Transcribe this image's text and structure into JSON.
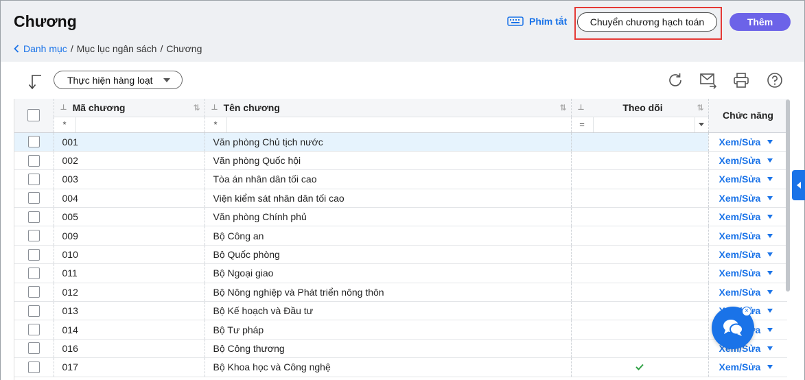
{
  "header": {
    "title": "Chương",
    "breadcrumb": {
      "back": "Danh mục",
      "sep1": "/",
      "item2": "Mục lục ngân sách",
      "sep2": "/",
      "item3": "Chương"
    },
    "shortcut_label": "Phím tắt",
    "move_button": "Chuyển chương hạch toán",
    "add_button": "Thêm"
  },
  "toolbar": {
    "bulk_label": "Thực hiện hàng loạt"
  },
  "table": {
    "columns": {
      "code": "Mã chương",
      "name": "Tên chương",
      "follow": "Theo dõi",
      "action": "Chức năng"
    },
    "filters": {
      "code": "*",
      "name": "*",
      "follow": "="
    },
    "action_label": "Xem/Sửa",
    "rows": [
      {
        "code": "001",
        "name": "Văn phòng Chủ tịch nước",
        "followed": false,
        "selected": true
      },
      {
        "code": "002",
        "name": "Văn phòng Quốc hội",
        "followed": false
      },
      {
        "code": "003",
        "name": "Tòa án nhân dân tối cao",
        "followed": false
      },
      {
        "code": "004",
        "name": "Viện kiểm sát nhân dân tối cao",
        "followed": false
      },
      {
        "code": "005",
        "name": "Văn phòng Chính phủ",
        "followed": false
      },
      {
        "code": "009",
        "name": "Bộ Công an",
        "followed": false
      },
      {
        "code": "010",
        "name": "Bộ Quốc phòng",
        "followed": false
      },
      {
        "code": "011",
        "name": "Bộ Ngoại giao",
        "followed": false
      },
      {
        "code": "012",
        "name": "Bộ Nông nghiệp và Phát triển nông thôn",
        "followed": false
      },
      {
        "code": "013",
        "name": "Bộ Kế hoạch và Đầu tư",
        "followed": false
      },
      {
        "code": "014",
        "name": "Bộ Tư pháp",
        "followed": false
      },
      {
        "code": "016",
        "name": "Bộ Công thương",
        "followed": false
      },
      {
        "code": "017",
        "name": "Bộ Khoa học và Công nghệ",
        "followed": true
      }
    ]
  },
  "chat": {
    "close_label": "×"
  },
  "colors": {
    "accent": "#1a73e8",
    "primary_button": "#6c63e8",
    "highlight": "#e53935",
    "check": "#2ea043"
  }
}
